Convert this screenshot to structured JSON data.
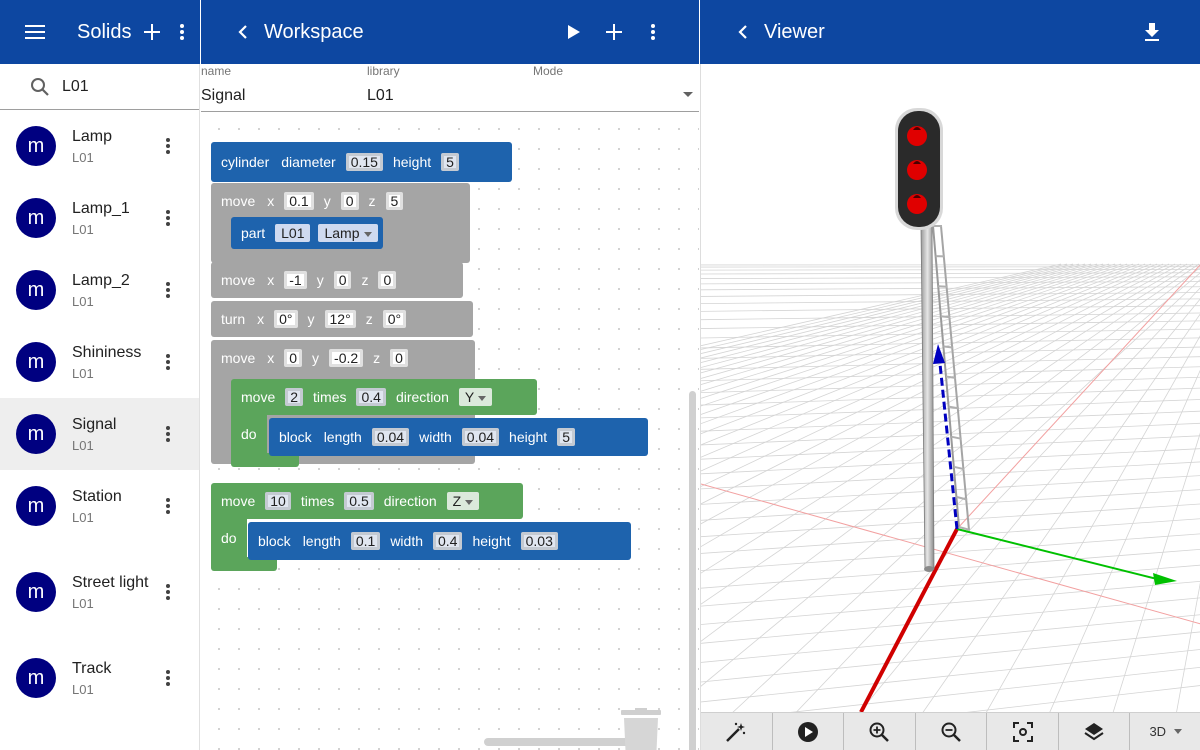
{
  "solids_panel": {
    "title": "Solids",
    "search_value": "L01",
    "items": [
      {
        "avatar": "m",
        "name": "Lamp",
        "library": "L01"
      },
      {
        "avatar": "m",
        "name": "Lamp_1",
        "library": "L01"
      },
      {
        "avatar": "m",
        "name": "Lamp_2",
        "library": "L01"
      },
      {
        "avatar": "m",
        "name": "Shininess",
        "library": "L01"
      },
      {
        "avatar": "m",
        "name": "Signal",
        "library": "L01"
      },
      {
        "avatar": "m",
        "name": "Station",
        "library": "L01"
      },
      {
        "avatar": "m",
        "name": "Street light",
        "library": "L01"
      },
      {
        "avatar": "m",
        "name": "Track",
        "library": "L01"
      }
    ],
    "selected": "Signal"
  },
  "workspace": {
    "title": "Workspace",
    "fields": {
      "name_label": "name",
      "name_value": "Signal",
      "library_label": "library",
      "library_value": "L01",
      "mode_label": "Mode",
      "mode_value": ""
    },
    "blocks": {
      "cylinder": {
        "label": "cylinder",
        "diameter_kw": "diameter",
        "diameter": "0.15",
        "height_kw": "height",
        "height": "5"
      },
      "move1": {
        "label": "move",
        "x_kw": "x",
        "x": "0.1",
        "y_kw": "y",
        "y": "0",
        "z_kw": "z",
        "z": "5"
      },
      "part": {
        "label": "part",
        "library": "L01",
        "name": "Lamp"
      },
      "move2": {
        "label": "move",
        "x_kw": "x",
        "x": "-1",
        "y_kw": "y",
        "y": "0",
        "z_kw": "z",
        "z": "0"
      },
      "turn": {
        "label": "turn",
        "x_kw": "x",
        "x": "0°",
        "y_kw": "y",
        "y": "12°",
        "z_kw": "z",
        "z": "0°"
      },
      "move3": {
        "label": "move",
        "x_kw": "x",
        "x": "0",
        "y_kw": "y",
        "y": "-0.2",
        "z_kw": "z",
        "z": "0"
      },
      "repeat1": {
        "label": "move",
        "count": "2",
        "times_kw": "times",
        "step": "0.4",
        "direction_kw": "direction",
        "direction": "Y",
        "do_kw": "do"
      },
      "block1": {
        "label": "block",
        "length_kw": "length",
        "length": "0.04",
        "width_kw": "width",
        "width": "0.04",
        "height_kw": "height",
        "height": "5"
      },
      "repeat2": {
        "label": "move",
        "count": "10",
        "times_kw": "times",
        "step": "0.5",
        "direction_kw": "direction",
        "direction": "Z",
        "do_kw": "do"
      },
      "block2": {
        "label": "block",
        "length_kw": "length",
        "length": "0.1",
        "width_kw": "width",
        "width": "0.4",
        "height_kw": "height",
        "height": "0.03"
      }
    }
  },
  "viewer": {
    "title": "Viewer",
    "view_mode": "3D",
    "toolbar_icons": [
      "magic-wand-icon",
      "play-icon",
      "zoom-in-icon",
      "zoom-out-icon",
      "fit-view-icon",
      "layers-icon"
    ]
  },
  "colors": {
    "appbar": "#0d47a1",
    "avatar": "#000080",
    "block_blue": "#1e63ad",
    "block_gray": "#a5a5a5",
    "block_green": "#5ba55b",
    "axis_x": "#d00000",
    "axis_y": "#00c000",
    "axis_z": "#0000c0"
  }
}
